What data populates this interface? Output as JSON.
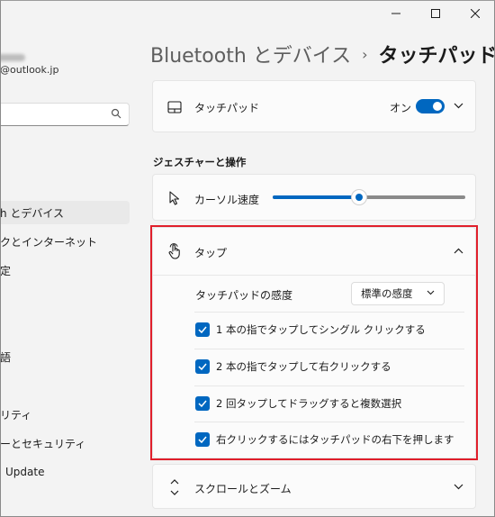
{
  "window": {
    "controls": [
      "minimize",
      "maximize",
      "close"
    ]
  },
  "account": {
    "email": "@outlook.jp"
  },
  "search": {
    "placeholder": ""
  },
  "sidebar": {
    "items": [
      {
        "label": "h とデバイス",
        "active": true
      },
      {
        "label": "クとインターネット",
        "active": false
      },
      {
        "label": "定",
        "active": false
      },
      {
        "label": "語",
        "active": false
      },
      {
        "label": "リティ",
        "active": false
      },
      {
        "label": "ーとセキュリティ",
        "active": false
      },
      {
        "label": "Update",
        "active": false
      }
    ]
  },
  "header": {
    "parent": "Bluetooth とデバイス",
    "separator": "›",
    "current": "タッチパッド"
  },
  "touchpad_card": {
    "label": "タッチパッド",
    "toggle_label": "オン",
    "toggle_on": true
  },
  "gestures_section": {
    "title": "ジェスチャーと操作"
  },
  "cursor_speed": {
    "label": "カーソル速度",
    "value_fraction": 0.45
  },
  "tap_section": {
    "label": "タップ",
    "sensitivity_label": "タッチパッドの感度",
    "sensitivity_value": "標準の感度",
    "options": [
      {
        "label": "1 本の指でタップしてシングル クリックする",
        "checked": true
      },
      {
        "label": "2 本の指でタップして右クリックする",
        "checked": true
      },
      {
        "label": "2 回タップしてドラッグすると複数選択",
        "checked": true
      },
      {
        "label": "右クリックするにはタッチパッドの右下を押します",
        "checked": true
      }
    ]
  },
  "scroll_zoom": {
    "label": "スクロールとズーム"
  },
  "colors": {
    "accent": "#0067c0",
    "highlight": "#e01f2b"
  }
}
